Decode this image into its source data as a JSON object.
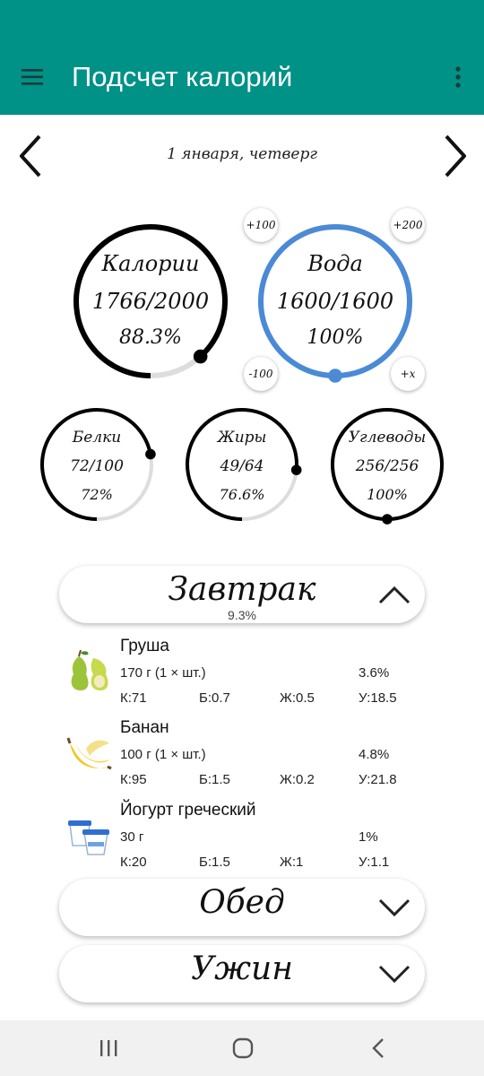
{
  "app": {
    "title": "Подсчет калорий"
  },
  "date": {
    "label": "1 января, четверг"
  },
  "calories": {
    "label": "Калории",
    "value": "1766/2000",
    "percent": "88.3%",
    "progress": 0.883
  },
  "water": {
    "label": "Вода",
    "value": "1600/1600",
    "percent": "100%",
    "progress": 1.0,
    "accent_color": "#4a8ad6",
    "buttons": {
      "add100": "+100",
      "add200": "+200",
      "minus100": "-100",
      "addx": "+x"
    }
  },
  "macros": {
    "protein": {
      "label": "Белки",
      "value": "72/100",
      "percent": "72%",
      "progress": 0.72
    },
    "fat": {
      "label": "Жиры",
      "value": "49/64",
      "percent": "76.6%",
      "progress": 0.766
    },
    "carbs": {
      "label": "Углеводы",
      "value": "256/256",
      "percent": "100%",
      "progress": 1.0
    }
  },
  "meals": {
    "breakfast": {
      "title": "Завтрак",
      "percent": "9.3%",
      "expanded": true,
      "items": [
        {
          "name": "Груша",
          "quantity": "170 г (1 × шт.)",
          "percent": "3.6%",
          "k": "К:71",
          "b": "Б:0.7",
          "zh": "Ж:0.5",
          "u": "У:18.5",
          "icon": "pear-icon"
        },
        {
          "name": "Банан",
          "quantity": "100 г (1 × шт.)",
          "percent": "4.8%",
          "k": "К:95",
          "b": "Б:1.5",
          "zh": "Ж:0.2",
          "u": "У:21.8",
          "icon": "banana-icon"
        },
        {
          "name": "Йогурт греческий",
          "quantity": "30 г",
          "percent": "1%",
          "k": "К:20",
          "b": "Б:1.5",
          "zh": "Ж:1",
          "u": "У:1.1",
          "icon": "yogurt-icon"
        }
      ]
    },
    "lunch": {
      "title": "Обед",
      "expanded": false
    },
    "dinner": {
      "title": "Ужин",
      "expanded": false
    }
  },
  "colors": {
    "appbar": "#009187",
    "ring_track": "#dddddd",
    "ring_fill": "#000000"
  }
}
